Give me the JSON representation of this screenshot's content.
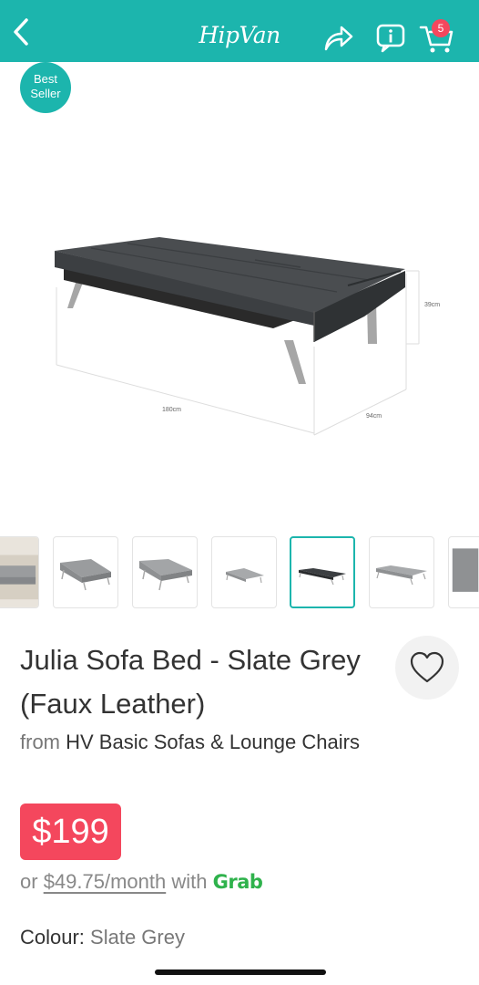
{
  "header": {
    "logo": "HipVan",
    "cart_count": "5",
    "background": "#1cb5ad"
  },
  "badge": {
    "line1": "Best",
    "line2": "Seller"
  },
  "hero": {
    "dimension_height": "39cm",
    "dimension_length": "180cm",
    "dimension_depth": "94cm"
  },
  "product": {
    "title": "Julia Sofa Bed - Slate Grey (Faux Leather)",
    "from_label": "from",
    "brand": "HV Basic Sofas & Lounge Chairs",
    "price": "$199",
    "installment_prefix": "or",
    "installment_amount": "$49.75/month",
    "installment_with": "with",
    "installment_provider": "Grab",
    "colour_label": "Colour:",
    "colour_value": "Slate Grey"
  },
  "thumbnails": [
    {
      "name": "lifestyle"
    },
    {
      "name": "grey-sofa-upright"
    },
    {
      "name": "grey-sofa-angle"
    },
    {
      "name": "grey-sofa-flat-small"
    },
    {
      "name": "dark-sofa-bed",
      "active": true
    },
    {
      "name": "grey-sofa-bed"
    },
    {
      "name": "grey-swatch"
    }
  ],
  "colors": {
    "accent": "#1cb5ad",
    "price_bg": "#f4475d",
    "grab_green": "#2fb24c"
  }
}
